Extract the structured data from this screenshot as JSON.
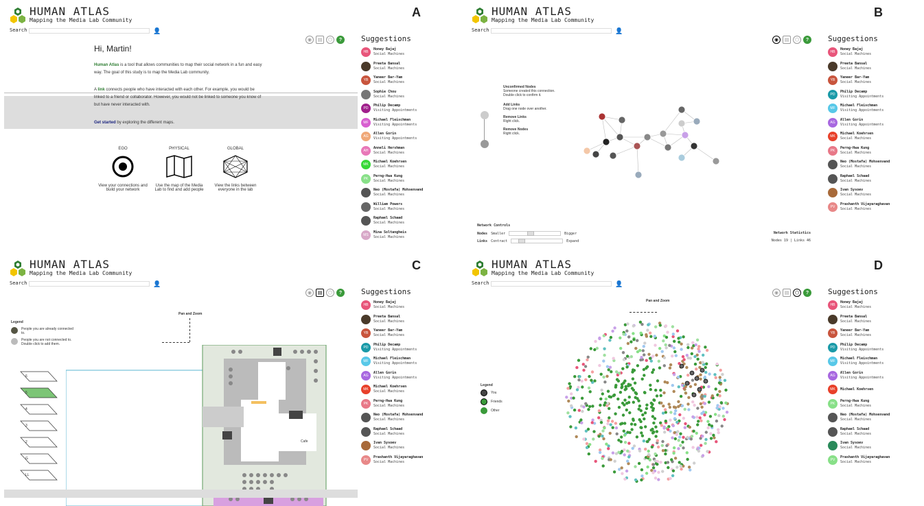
{
  "app": {
    "title": "HUMAN ATLAS",
    "subtitle": "Mapping the Media Lab Community",
    "search_label": "Search"
  },
  "panels": [
    "A",
    "B",
    "C",
    "D"
  ],
  "colors": {
    "green": "#3a9a3a",
    "accent": "#5a8a2a"
  },
  "suggestions_title": "Suggestions",
  "suggestions_A": [
    {
      "initials": "HB",
      "name": "Honey Bajaj",
      "role": "Social Machines",
      "color": "#e8557a"
    },
    {
      "initials": "",
      "name": "Preeta Bansal",
      "role": "Social Machines",
      "color": "#4a3a2a"
    },
    {
      "initials": "YB",
      "name": "Yaneer Bar-Yam",
      "role": "Social Machines",
      "color": "#c8553d"
    },
    {
      "initials": "",
      "name": "Sophie Chou",
      "role": "Social Machines",
      "color": "#777"
    },
    {
      "initials": "PD",
      "name": "Philip Decamp",
      "role": "Visiting Appointments",
      "color": "#a0208c"
    },
    {
      "initials": "MF",
      "name": "Michael Fleischman",
      "role": "Visiting Appointments",
      "color": "#d85fd0"
    },
    {
      "initials": "AG",
      "name": "Allen Gorin",
      "role": "Visiting Appointments",
      "color": "#f0a878"
    },
    {
      "initials": "AH",
      "name": "Anneli Hershman",
      "role": "Social Machines",
      "color": "#e878b8"
    },
    {
      "initials": "MK",
      "name": "Michael Koehrsen",
      "role": "Social Machines",
      "color": "#38d838"
    },
    {
      "initials": "PK",
      "name": "Perng-Hwa Kung",
      "role": "Social Machines",
      "color": "#88e088"
    },
    {
      "initials": "",
      "name": "Neo (Mostafa) Mohsenvand",
      "role": "Social Machines",
      "color": "#555"
    },
    {
      "initials": "",
      "name": "William Powers",
      "role": "Social Machines",
      "color": "#666"
    },
    {
      "initials": "",
      "name": "Raphael Schaad",
      "role": "Social Machines",
      "color": "#555"
    },
    {
      "initials": "MS",
      "name": "Mina Soltangheis",
      "role": "Social Machines",
      "color": "#d8a8c8"
    }
  ],
  "suggestions_B": [
    {
      "initials": "HB",
      "name": "Honey Bajaj",
      "role": "Social Machines",
      "color": "#e8557a"
    },
    {
      "initials": "",
      "name": "Preeta Bansal",
      "role": "Social Machines",
      "color": "#4a3a2a"
    },
    {
      "initials": "YB",
      "name": "Yaneer Bar-Yam",
      "role": "Social Machines",
      "color": "#c8553d"
    },
    {
      "initials": "PD",
      "name": "Philip Decamp",
      "role": "Visiting Appointments",
      "color": "#1a9aa8"
    },
    {
      "initials": "MF",
      "name": "Michael Fleischman",
      "role": "Visiting Appointments",
      "color": "#58c8e8"
    },
    {
      "initials": "AG",
      "name": "Allen Gorin",
      "role": "Visiting Appointments",
      "color": "#a868e0"
    },
    {
      "initials": "MK",
      "name": "Michael Koehrsen",
      "role": "Social Machines",
      "color": "#e8402a"
    },
    {
      "initials": "PK",
      "name": "Perng-Hwa Kung",
      "role": "Social Machines",
      "color": "#e87888"
    },
    {
      "initials": "",
      "name": "Neo (Mostafa) Mohsenvand",
      "role": "Social Machines",
      "color": "#555"
    },
    {
      "initials": "",
      "name": "Raphael Schaad",
      "role": "Social Machines",
      "color": "#555"
    },
    {
      "initials": "",
      "name": "Ivan Sysoev",
      "role": "Social Machines",
      "color": "#a86a3a"
    },
    {
      "initials": "PV",
      "name": "Prashanth Vijayaraghavan",
      "role": "Social Machines",
      "color": "#e88888"
    }
  ],
  "suggestions_D": [
    {
      "initials": "HB",
      "name": "Honey Bajaj",
      "role": "Social Machines",
      "color": "#e8557a"
    },
    {
      "initials": "",
      "name": "Preeta Bansal",
      "role": "Social Machines",
      "color": "#4a3a2a"
    },
    {
      "initials": "YB",
      "name": "Yaneer Bar-Yam",
      "role": "Social Machines",
      "color": "#c8553d"
    },
    {
      "initials": "PD",
      "name": "Philip Decamp",
      "role": "Visiting Appointments",
      "color": "#1a9aa8"
    },
    {
      "initials": "MF",
      "name": "Michael Fleischman",
      "role": "Visiting Appointments",
      "color": "#58c8e8"
    },
    {
      "initials": "AG",
      "name": "Allen Gorin",
      "role": "Visiting Appointments",
      "color": "#a868e0"
    },
    {
      "initials": "MK",
      "name": "Michael Koehrsen",
      "role": "",
      "color": "#e8402a"
    },
    {
      "initials": "PK",
      "name": "Perng-Hwa Kung",
      "role": "Social Machines",
      "color": "#88e088"
    },
    {
      "initials": "",
      "name": "Neo (Mostafa) Mohsenvand",
      "role": "Social Machines",
      "color": "#555"
    },
    {
      "initials": "",
      "name": "Raphael Schaad",
      "role": "Social Machines",
      "color": "#555"
    },
    {
      "initials": "",
      "name": "Ivan Sysoev",
      "role": "Social Machines",
      "color": "#2a8a5a"
    },
    {
      "initials": "PV",
      "name": "Prashanth Vijayaraghavan",
      "role": "Social Machines",
      "color": "#88e088"
    }
  ],
  "welcome": {
    "greeting": "Hi, Martin!",
    "p1_strong": "Human Atlas",
    "p1": " is a tool that allows communities to map their social network in a fun and easy way. The goal of this study is to map the Media Lab community.",
    "p2_a": "A ",
    "p2_link": "link",
    "p2_b": " connects people who have interacted with each other. For example, you would be linked to a friend or collaborator. However, you would not be linked to someone you know of but have never interacted with.",
    "p3_link": "Get started",
    "p3": " by exploring the different maps.",
    "maps": [
      {
        "title": "EGO",
        "desc": "View your connections and build your network"
      },
      {
        "title": "PHYSICAL",
        "desc": "Use the map of the Media Lab to find and add people"
      },
      {
        "title": "GLOBAL",
        "desc": "View the links between everyone in the lab"
      }
    ]
  },
  "ego": {
    "help": [
      {
        "title": "Unconfirmed Nodes",
        "desc": "Someone created this connection. Double click to confirm it."
      },
      {
        "title": "Add Links",
        "desc": "Drag one node over another."
      },
      {
        "title": "Remove Links",
        "desc": "Right click."
      },
      {
        "title": "Remove Nodes",
        "desc": "Right click."
      }
    ],
    "controls_title": "Network Controls",
    "nodes_label": "Nodes",
    "smaller": "Smaller",
    "bigger": "Bigger",
    "links_label": "Links",
    "contract": "Contract",
    "expand": "Expand",
    "stats_title": "Network Statistics",
    "stats": "Nodes 19 | Links 46",
    "nodes_count": 19,
    "links_count": 46
  },
  "physical": {
    "legend_title": "Legend",
    "legend": [
      "People you are already connected to.",
      "People you are not connected to. Double click to add them."
    ],
    "pan_zoom": "Pan and Zoom",
    "floors": [
      "6",
      "5",
      "4",
      "3",
      "2",
      "G",
      "LL"
    ],
    "cafe": "Cafe"
  },
  "global": {
    "pan_zoom": "Pan and Zoom",
    "legend_title": "Legend",
    "legend": [
      "You",
      "Friends",
      "Other"
    ]
  }
}
